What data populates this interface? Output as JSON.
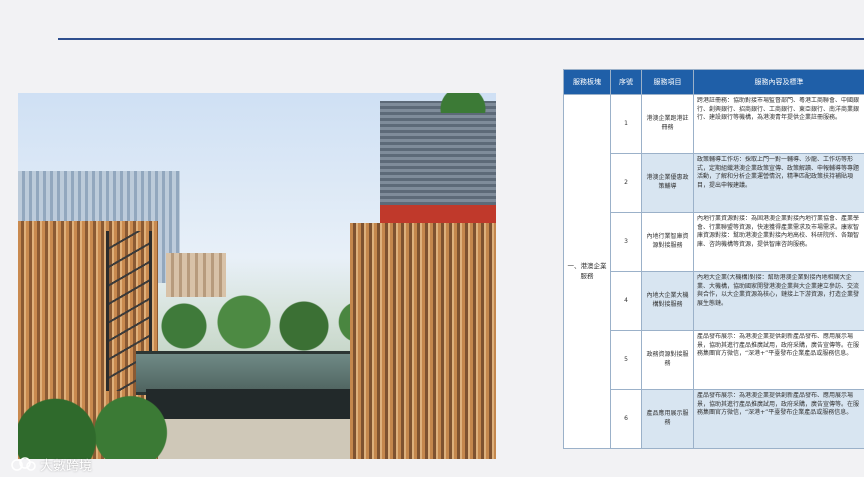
{
  "watermark": {
    "text": "大數跨境",
    "icon": "cloud-logo-icon"
  },
  "colors": {
    "header_bg": "#1f5fa8",
    "rule": "#2f4f8e",
    "band": "#d8e5f1"
  },
  "table": {
    "headers": [
      "服務板塊",
      "序號",
      "服務項目",
      "服務內容及標準"
    ],
    "block": "一、港澳企業服務",
    "rows": [
      {
        "no": "1",
        "item": "港澳企業跑港註冊務",
        "content": "跨港註冊務：協助對接市場監督部門、粵港工商聯會、中國銀行、創興銀行、招商銀行、工商銀行、東亞銀行、南洋商業銀行、建設銀行等機構，為港澳青年提供企業註冊服務。"
      },
      {
        "no": "2",
        "item": "港澳企業優惠政策輔導",
        "content": "政策輔導工作坊：採取上門一對一輔導、沙龍、工作坊等形式，定期組織港澳企業政策宣傳、政策解讀、申報輔導等專題活動，了解和分析企業運營情況，精準匹配政策扶持補貼項目，提出申報建議。"
      },
      {
        "no": "3",
        "item": "內地行業智庫資源對接服務",
        "content": "內地行業資源對接：為固港澳企業對接內地行業協會、產業學會、行業聯盟等資源，快速獲得產業需求及市場需求。康家智庫資源對接：幫助港澳企業對接內地高校、科研院所、各類智庫、咨詢機構等資源，提供智庫咨詢服務。"
      },
      {
        "no": "4",
        "item": "內地大企業大機構對接服務",
        "content": "內地大企業(大機構)對接：幫助港澳企業對接內地相關大企業、大機構，協助國家開發港澳企業與大企業建立參訪、交流與合作，以大企業資源為核心，鏈接上下游資源，打造企業發展生態鏈。"
      },
      {
        "no": "5",
        "item": "政務資源對接服務",
        "content": "產品發布展示：為港澳企業提供創新產品發布、應用展示場景，協助其進行產品推廣試用，政府采購，廣告宣傳等。在服務集團官方微信，“深港+”平臺發布企業產品或服務信息。"
      },
      {
        "no": "6",
        "item": "產品應用展示服務",
        "content": "產品發布展示：為港澳企業提供創新產品發布、應用展示場景，協助其進行產品推廣試用，政府采購，廣告宣傳等。在服務集團官方微信，“深港+”平臺發布企業產品或服務信息。"
      }
    ]
  }
}
